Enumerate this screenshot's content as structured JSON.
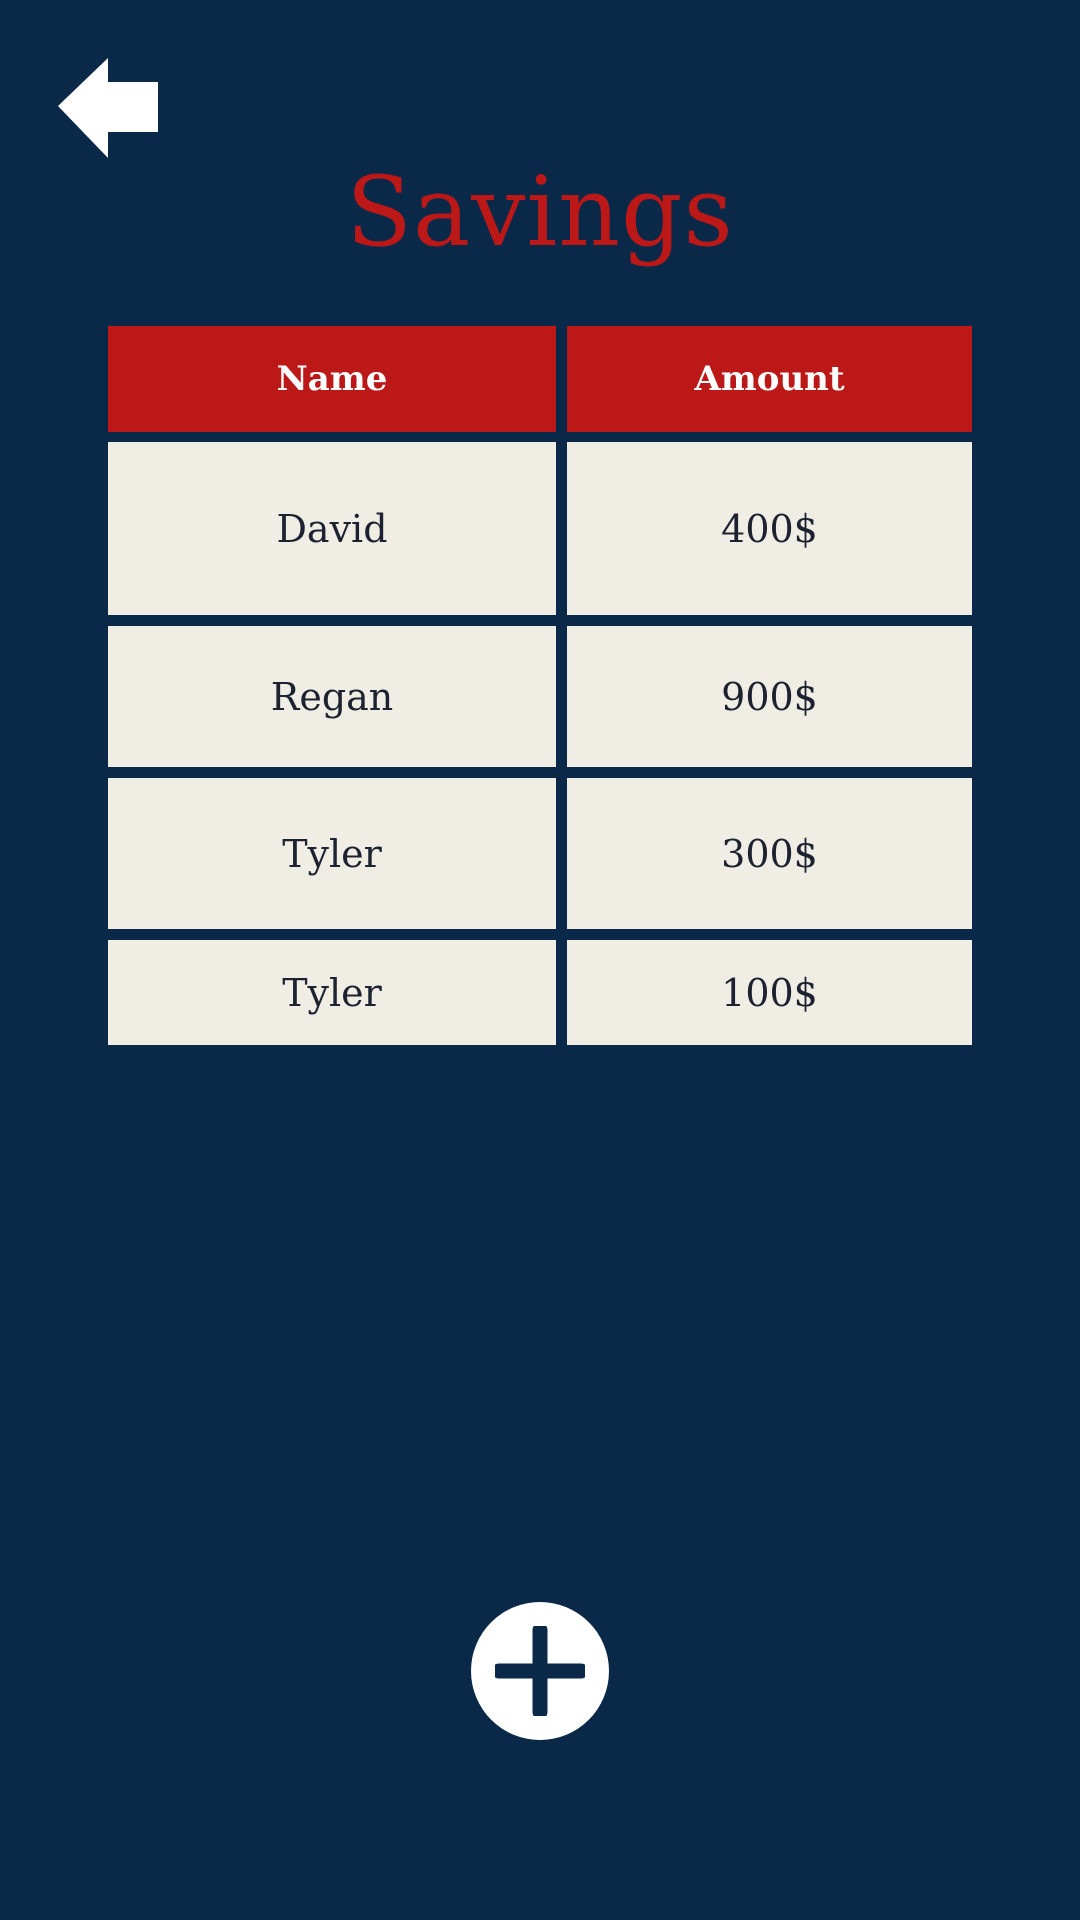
{
  "header": {
    "title": "Savings",
    "back_icon": "arrow-left-icon"
  },
  "table": {
    "columns": [
      "Name",
      "Amount"
    ],
    "rows": [
      {
        "name": "David",
        "amount": "400$"
      },
      {
        "name": "Regan",
        "amount": "900$"
      },
      {
        "name": "Tyler",
        "amount": "300$"
      },
      {
        "name": "Tyler",
        "amount": "100$"
      }
    ]
  },
  "actions": {
    "add_icon": "plus-icon"
  },
  "colors": {
    "background": "#0a2948",
    "accent": "#bd1818",
    "cell": "#efede4",
    "text": "#1c2230",
    "white": "#ffffff"
  }
}
